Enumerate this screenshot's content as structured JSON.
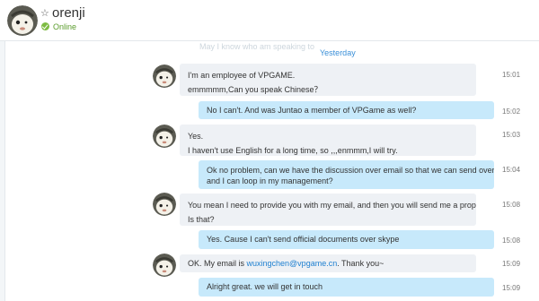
{
  "contact": {
    "name": "orenji",
    "status": "Online",
    "favorite_icon": "star-outline-icon",
    "status_color": "#7dbb42"
  },
  "conversation": {
    "faded_preview": "May I know who am speaking to",
    "date_separator": "Yesterday",
    "messages": [
      {
        "direction": "in",
        "lines": [
          "I'm an employee of VPGAME.",
          "emmmmm,Can you speak Chinese？"
        ],
        "time": "15:01"
      },
      {
        "direction": "out",
        "lines": [
          "No I can't. And was Juntao a member of VPGame as well?"
        ],
        "time": "15:02"
      },
      {
        "direction": "in",
        "lines": [
          "Yes.",
          "I haven't use English for a long time, so ,,,enmmm,I will try."
        ],
        "time": "15:03"
      },
      {
        "direction": "out",
        "lines": [
          "Ok no problem, can we have the discussion over email so that we can send over a proposal",
          "and I can loop in my management?"
        ],
        "time": "15:04"
      },
      {
        "direction": "in",
        "lines": [
          "You mean I need to provide you with my email, and then you will send me a proposal?",
          "Is that?"
        ],
        "time": "15:08"
      },
      {
        "direction": "out",
        "lines": [
          "Yes. Cause I can't send official documents over skype"
        ],
        "time": "15:08"
      },
      {
        "direction": "in",
        "prefix": "OK. My email is ",
        "link": "wuxingchen@vpgame.cn",
        "suffix": ". Thank you~",
        "time": "15:09"
      },
      {
        "direction": "out",
        "lines": [
          "Alright great. we will get in touch"
        ],
        "time": "15:09"
      }
    ]
  },
  "colors": {
    "incoming_bubble": "#eef1f5",
    "outgoing_bubble": "#c7e9fb",
    "link": "#1d7fd0",
    "date_separator": "#3a8fd8"
  }
}
